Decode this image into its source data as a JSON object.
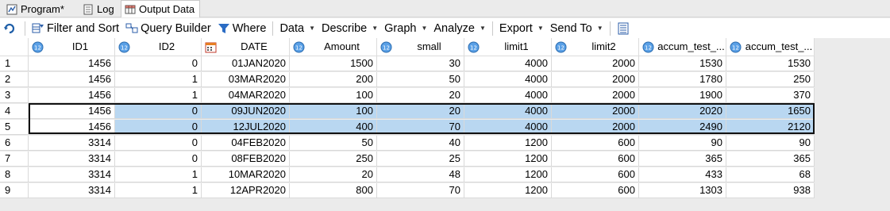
{
  "tabs": [
    {
      "label": "Program*",
      "icon": "program-icon"
    },
    {
      "label": "Log",
      "icon": "log-icon"
    },
    {
      "label": "Output Data",
      "icon": "output-data-icon",
      "active": true
    }
  ],
  "toolbar": {
    "filter_sort": "Filter and Sort",
    "query_builder": "Query Builder",
    "where": "Where",
    "menus": [
      "Data",
      "Describe",
      "Graph",
      "Analyze",
      "Export",
      "Send To"
    ]
  },
  "columns": [
    "ID1",
    "ID2",
    "DATE",
    "Amount",
    "small",
    "limit1",
    "limit2",
    "accum_test_...",
    "accum_test_..."
  ],
  "rows": [
    [
      "1",
      "1456",
      "0",
      "01JAN2020",
      "1500",
      "30",
      "4000",
      "2000",
      "1530",
      "1530"
    ],
    [
      "2",
      "1456",
      "1",
      "03MAR2020",
      "200",
      "50",
      "4000",
      "2000",
      "1780",
      "250"
    ],
    [
      "3",
      "1456",
      "1",
      "04MAR2020",
      "100",
      "20",
      "4000",
      "2000",
      "1900",
      "370"
    ],
    [
      "4",
      "1456",
      "0",
      "09JUN2020",
      "100",
      "20",
      "4000",
      "2000",
      "2020",
      "1650"
    ],
    [
      "5",
      "1456",
      "0",
      "12JUL2020",
      "400",
      "70",
      "4000",
      "2000",
      "2490",
      "2120"
    ],
    [
      "6",
      "3314",
      "0",
      "04FEB2020",
      "50",
      "40",
      "1200",
      "600",
      "90",
      "90"
    ],
    [
      "7",
      "3314",
      "0",
      "08FEB2020",
      "250",
      "25",
      "1200",
      "600",
      "365",
      "365"
    ],
    [
      "8",
      "3314",
      "1",
      "10MAR2020",
      "20",
      "48",
      "1200",
      "600",
      "433",
      "68"
    ],
    [
      "9",
      "3314",
      "1",
      "12APR2020",
      "800",
      "70",
      "1200",
      "600",
      "1303",
      "938"
    ]
  ],
  "selected_rows": [
    4,
    5
  ]
}
